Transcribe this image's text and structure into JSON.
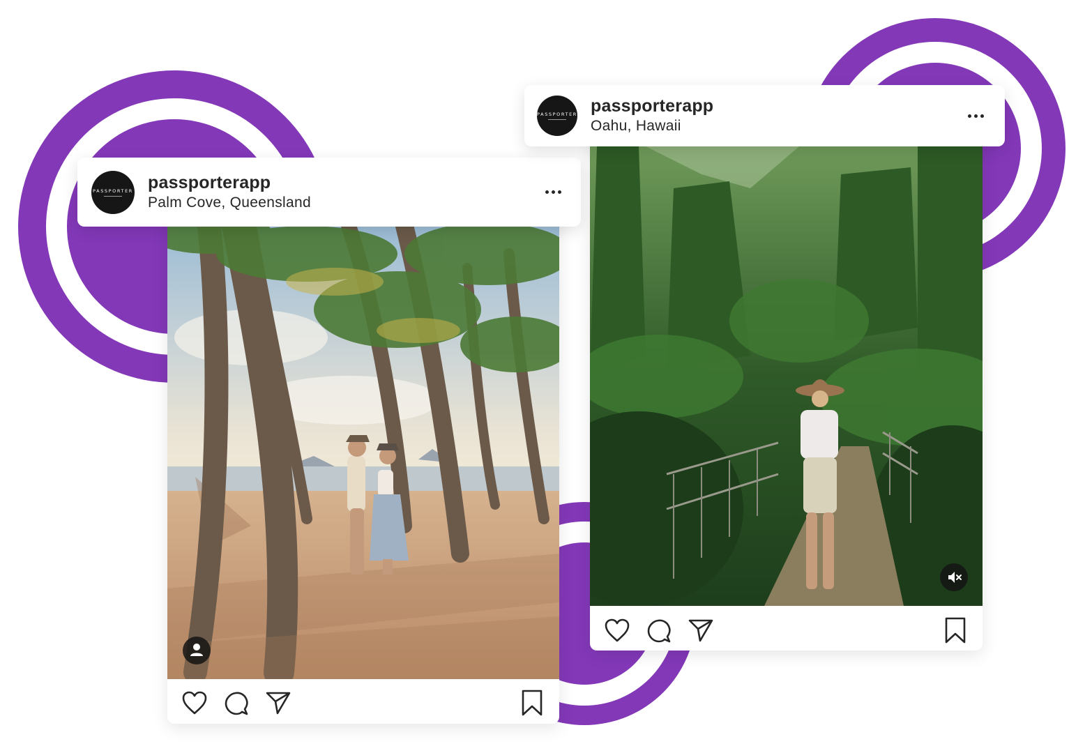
{
  "colors": {
    "accent_purple": "#8338b8",
    "text_primary": "#262626"
  },
  "posts": [
    {
      "username": "passporterapp",
      "location": "Palm Cove, Queensland",
      "avatar_text": "PASSPORTER",
      "image_description_icon": "user-tag-icon",
      "actions": [
        "heart-icon",
        "comment-icon",
        "share-icon",
        "bookmark-icon"
      ]
    },
    {
      "username": "passporterapp",
      "location": "Oahu, Hawaii",
      "avatar_text": "PASSPORTER",
      "image_description_icon": "mute-icon",
      "actions": [
        "heart-icon",
        "comment-icon",
        "share-icon",
        "bookmark-icon"
      ]
    }
  ]
}
